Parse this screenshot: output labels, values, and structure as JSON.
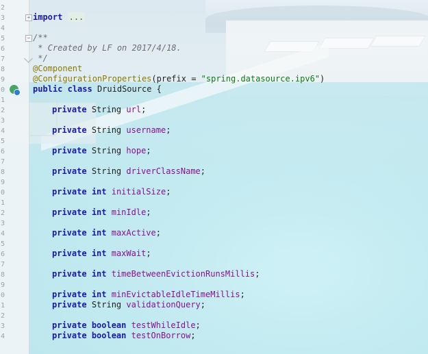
{
  "gutter": {
    "line_numbers": [
      "2",
      "3",
      "4",
      "5",
      "6",
      "7",
      "8",
      "9",
      "0",
      "1",
      "2",
      "3",
      "4",
      "5",
      "6",
      "7",
      "8",
      "9",
      "0",
      "1",
      "2",
      "3",
      "4",
      "5",
      "6",
      "7",
      "8",
      "9",
      "0",
      "1",
      "2",
      "3",
      "4"
    ]
  },
  "code": {
    "import_kw": "import",
    "import_dots": "...",
    "c1": "/**",
    "c2": " * Created by LF on 2017/4/18.",
    "c3": " */",
    "anno1": "@Component",
    "anno2": "@ConfigurationProperties",
    "anno2_open": "(prefix = ",
    "anno2_str": "\"spring.datasource.ipv6\"",
    "anno2_close": ")",
    "class_public": "public",
    "class_kw": "class",
    "class_name": "DruidSource {",
    "fields": [
      {
        "mod": "private",
        "type": "String",
        "name": "url"
      },
      {
        "mod": "private",
        "type": "String",
        "name": "username"
      },
      {
        "mod": "private",
        "type": "String",
        "name": "hope"
      },
      {
        "mod": "private",
        "type": "String",
        "name": "driverClassName"
      },
      {
        "mod": "private",
        "type": "int",
        "name": "initialSize"
      },
      {
        "mod": "private",
        "type": "int",
        "name": "minIdle"
      },
      {
        "mod": "private",
        "type": "int",
        "name": "maxActive"
      },
      {
        "mod": "private",
        "type": "int",
        "name": "maxWait"
      },
      {
        "mod": "private",
        "type": "int",
        "name": "timeBetweenEvictionRunsMillis"
      },
      {
        "mod": "private",
        "type": "int",
        "name": "minEvictableIdleTimeMillis"
      },
      {
        "mod": "private",
        "type": "String",
        "name": "validationQuery"
      },
      {
        "mod": "private",
        "type": "boolean",
        "name": "testWhileIdle"
      },
      {
        "mod": "private",
        "type": "boolean",
        "name": "testOnBorrow"
      }
    ]
  }
}
